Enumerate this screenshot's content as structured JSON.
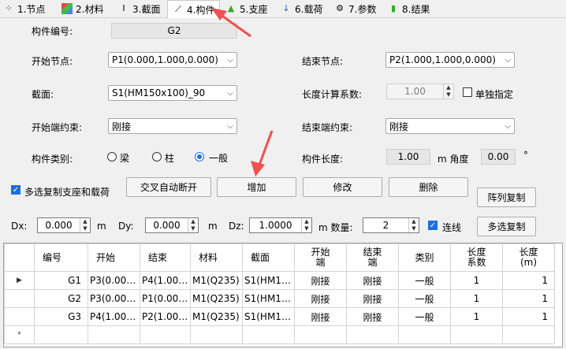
{
  "tabs": [
    {
      "label": "1.节点",
      "icon": "node-icon"
    },
    {
      "label": "2.材料",
      "icon": "material-icon"
    },
    {
      "label": "3.截面",
      "icon": "section-icon"
    },
    {
      "label": "4.构件",
      "icon": "member-icon"
    },
    {
      "label": "5.支座",
      "icon": "support-icon"
    },
    {
      "label": "6.载荷",
      "icon": "load-icon"
    },
    {
      "label": "7.参数",
      "icon": "params-icon"
    },
    {
      "label": "8.结果",
      "icon": "results-icon"
    }
  ],
  "form": {
    "member_id_label": "构件编号:",
    "member_id": "G2",
    "start_node_label": "开始节点:",
    "start_node": "P1(0.000,1.000,0.000)",
    "end_node_label": "结束节点:",
    "end_node": "P2(1.000,1.000,0.000)",
    "section_label": "截面:",
    "section": "S1(HM150x100)_90",
    "length_factor_label": "长度计算系数:",
    "length_factor": "1.00",
    "separate_label": "单独指定",
    "start_constraint_label": "开始端约束:",
    "start_constraint": "刚接",
    "end_constraint_label": "结束端约束:",
    "end_constraint": "刚接",
    "type_label": "构件类别:",
    "type_beam": "梁",
    "type_column": "柱",
    "type_general": "一般",
    "member_length_label": "构件长度:",
    "member_length": "1.00",
    "angle_label": "m 角度",
    "angle": "0.00",
    "degree": "°"
  },
  "actions": {
    "multi_copy_support_load": "多选复制支座和载荷",
    "cross_auto_break": "交叉自动断开",
    "add": "增加",
    "modify": "修改",
    "delete": "删除",
    "array_copy": "阵列复制",
    "multi_copy": "多选复制"
  },
  "offsets": {
    "dx_label": "Dx:",
    "dx": "0.000",
    "dx_unit": "m",
    "dy_label": "Dy:",
    "dy": "0.000",
    "dy_unit": "m",
    "dz_label": "Dz:",
    "dz": "1.0000",
    "count_label": "m 数量:",
    "count": "2",
    "chain_label": "连线"
  },
  "table": {
    "columns": [
      "编号",
      "开始",
      "结束",
      "材料",
      "截面",
      "开始\n端",
      "结束\n端",
      "类别",
      "长度\n系数",
      "长度\n(m)"
    ],
    "rows": [
      [
        "G1",
        "P3(0.00…",
        "P4(1.00…",
        "M1(Q235)",
        "S1(HM1…",
        "刚接",
        "刚接",
        "一般",
        "1",
        "1"
      ],
      [
        "G2",
        "P3(0.00…",
        "P1(0.00…",
        "M1(Q235)",
        "S1(HM1…",
        "刚接",
        "刚接",
        "一般",
        "1",
        "1"
      ],
      [
        "G3",
        "P4(1.00…",
        "P2(1.00…",
        "M1(Q235)",
        "S1(HM1…",
        "刚接",
        "刚接",
        "一般",
        "1",
        "1"
      ]
    ]
  },
  "colors": {
    "accent": "#1e6fd9",
    "annotation": "#f0504f"
  }
}
